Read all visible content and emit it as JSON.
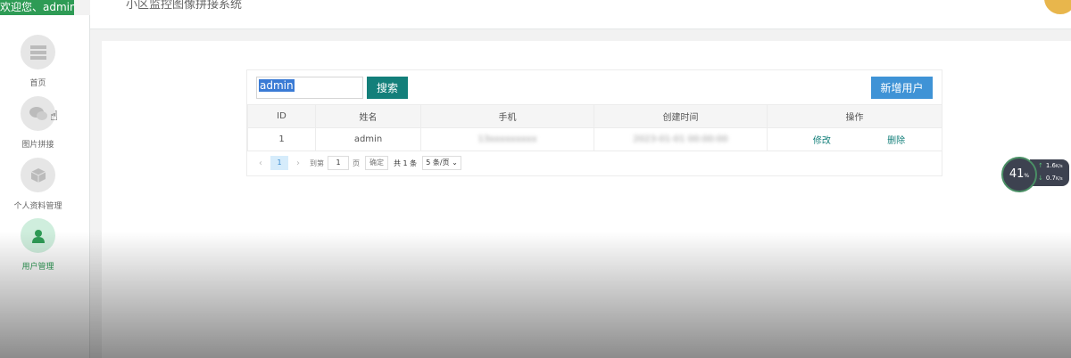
{
  "header": {
    "welcome": "欢迎您、admin",
    "app_title": "小区监控图像拼接系统"
  },
  "sidebar": {
    "items": [
      {
        "label": "首页",
        "icon": "home-icon"
      },
      {
        "label": "图片拼接",
        "icon": "chat-icon"
      },
      {
        "label": "个人资料管理",
        "icon": "box-icon"
      },
      {
        "label": "用户管理",
        "icon": "user-icon",
        "active": true
      }
    ]
  },
  "toolbar": {
    "search_value": "admin",
    "search_label": "搜索",
    "add_label": "新增用户"
  },
  "table": {
    "columns": [
      "ID",
      "姓名",
      "手机",
      "创建时间",
      "操作"
    ],
    "rows": [
      {
        "id": "1",
        "name": "admin",
        "phone": "13xxxxxxxxx",
        "created": "2023-01-01 00:00:00",
        "edit": "修改",
        "delete": "删除"
      }
    ]
  },
  "pagination": {
    "prev": "‹",
    "current_page": "1",
    "next": "›",
    "goto_prefix": "到第",
    "goto_value": "1",
    "goto_suffix": "页",
    "confirm": "确定",
    "total": "共 1 条",
    "page_size": "5 条/页"
  },
  "net_monitor": {
    "percent": "41",
    "percent_unit": "%",
    "up_rate": "1.6",
    "down_rate": "0.7",
    "rate_unit": "K/s"
  },
  "colors": {
    "accent_green": "#2e9b55",
    "search_button": "#137f7a",
    "add_button": "#3f93d6"
  }
}
